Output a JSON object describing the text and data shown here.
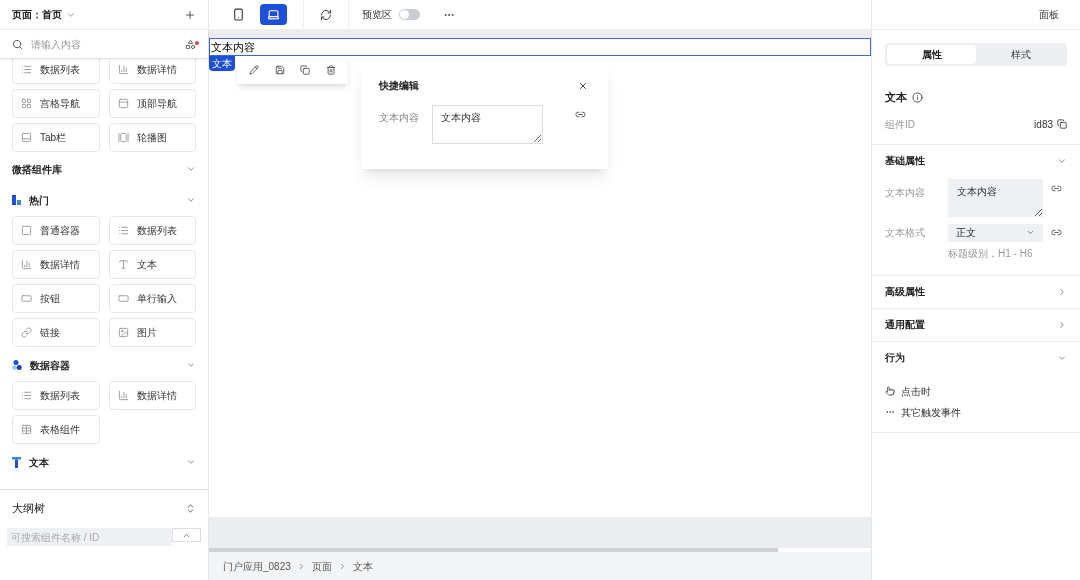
{
  "left_panel": {
    "page_selector": "页面：首页",
    "search": {
      "placeholder": "请输入内容"
    },
    "top_components": [
      {
        "label": "数据列表",
        "kind": "list"
      },
      {
        "label": "数据详情",
        "kind": "detail"
      },
      {
        "label": "宫格导航",
        "kind": "grid"
      },
      {
        "label": "顶部导航",
        "kind": "topnav"
      },
      {
        "label": "Tab栏",
        "kind": "tabbar"
      },
      {
        "label": "轮播图",
        "kind": "carousel"
      }
    ],
    "library": {
      "title": "微搭组件库",
      "expanded": true,
      "groups": [
        {
          "title": "热门",
          "kind": "hot",
          "expanded": true,
          "items": [
            {
              "label": "普通容器",
              "kind": "container"
            },
            {
              "label": "数据列表",
              "kind": "list"
            },
            {
              "label": "数据详情",
              "kind": "detail"
            },
            {
              "label": "文本",
              "kind": "text"
            },
            {
              "label": "按钮",
              "kind": "button"
            },
            {
              "label": "单行输入",
              "kind": "input"
            },
            {
              "label": "链接",
              "kind": "link"
            },
            {
              "label": "图片",
              "kind": "image"
            }
          ]
        },
        {
          "title": "数据容器",
          "kind": "data",
          "expanded": true,
          "items": [
            {
              "label": "数据列表",
              "kind": "list"
            },
            {
              "label": "数据详情",
              "kind": "detail"
            },
            {
              "label": "表格组件",
              "kind": "table"
            }
          ]
        },
        {
          "title": "文本",
          "kind": "text",
          "expanded": true
        }
      ]
    },
    "outline": {
      "title": "大纲树",
      "search": {
        "placeholder": "可搜索组件名称 / ID"
      }
    }
  },
  "toolbar": {
    "devices": [
      {
        "kind": "phone",
        "selected": false
      },
      {
        "kind": "desktop",
        "selected": true
      }
    ],
    "preview": {
      "label": "预览区",
      "on": false
    },
    "panel_button": "面板"
  },
  "canvas": {
    "element_text": "文本内容",
    "element_tag": "文本",
    "quick_edit": {
      "title": "快捷编辑",
      "field_label": "文本内容",
      "value": "文本内容"
    },
    "breadcrumb": [
      "门户应用_0823",
      "页面",
      "文本"
    ]
  },
  "right_panel": {
    "tabs": [
      {
        "label": "属性",
        "selected": true
      },
      {
        "label": "样式",
        "selected": false
      }
    ],
    "component": {
      "title": "文本",
      "id_label": "组件ID",
      "id": "id83"
    },
    "sections": [
      {
        "title": "基础属性",
        "kind": "basic",
        "expanded": true,
        "content_label": "文本内容",
        "content_value": "文本内容",
        "format_label": "文本格式",
        "format_value": "正文",
        "format_hint": "标题级别，H1 - H6"
      },
      {
        "title": "高级属性",
        "expanded": false
      },
      {
        "title": "通用配置",
        "expanded": false
      },
      {
        "title": "行为",
        "kind": "behavior",
        "expanded": true,
        "events": [
          {
            "label": "点击时",
            "kind": "click"
          },
          {
            "label": "其它触发事件",
            "kind": "more"
          }
        ]
      }
    ]
  }
}
